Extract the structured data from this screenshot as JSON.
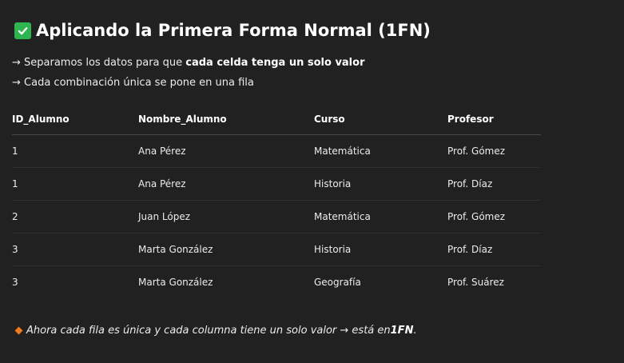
{
  "title": "Aplicando la Primera Forma Normal (1FN)",
  "intro": {
    "line1_prefix": "→ Separamos los datos para que ",
    "line1_bold": "cada celda tenga un solo valor",
    "line2": "→ Cada combinación única se pone en una fila"
  },
  "table": {
    "headers": [
      "ID_Alumno",
      "Nombre_Alumno",
      "Curso",
      "Profesor"
    ],
    "rows": [
      [
        "1",
        "Ana Pérez",
        "Matemática",
        "Prof. Gómez"
      ],
      [
        "1",
        "Ana Pérez",
        "Historia",
        "Prof. Díaz"
      ],
      [
        "2",
        "Juan López",
        "Matemática",
        "Prof. Gómez"
      ],
      [
        "3",
        "Marta González",
        "Historia",
        "Prof. Díaz"
      ],
      [
        "3",
        "Marta González",
        "Geografía",
        "Prof. Suárez"
      ]
    ]
  },
  "note": {
    "text": "Ahora cada fila es única y cada columna tiene un solo valor → está en ",
    "bold": "1FN",
    "suffix": "."
  },
  "icons": {
    "title_icon": "check-mark-icon",
    "note_icon": "orange-diamond-icon"
  },
  "colors": {
    "background": "#212121",
    "check": "#2fb54f",
    "diamond": "#f07b1f"
  }
}
